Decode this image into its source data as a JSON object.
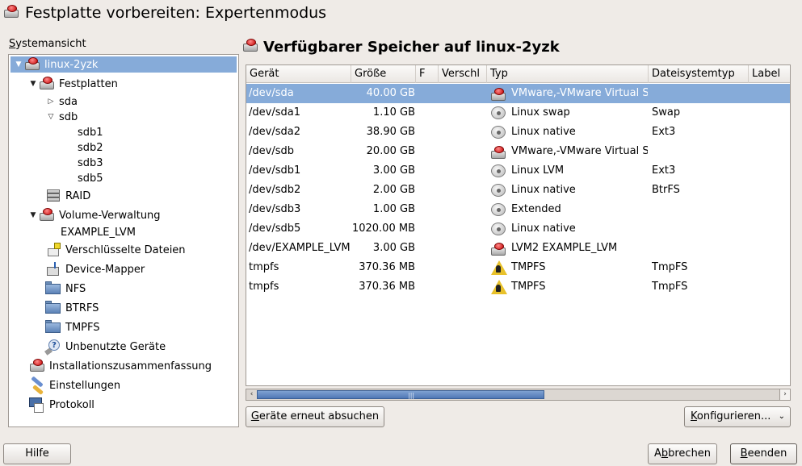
{
  "window": {
    "title": "Festplatte vorbereiten: Expertenmodus"
  },
  "sidebar": {
    "label": "Systemansicht",
    "tree": [
      {
        "label": "linux-2yzk",
        "icon": "harddisk-red-icon",
        "expanded": true,
        "selected": true
      },
      {
        "label": "Festplatten",
        "icon": "harddisk-red-icon",
        "expanded": true
      },
      {
        "label": "sda",
        "expanded": false
      },
      {
        "label": "sdb",
        "expanded": true
      },
      {
        "label": "sdb1"
      },
      {
        "label": "sdb2"
      },
      {
        "label": "sdb3"
      },
      {
        "label": "sdb5"
      },
      {
        "label": "RAID",
        "icon": "raid-icon"
      },
      {
        "label": "Volume-Verwaltung",
        "icon": "harddisk-red-icon",
        "expanded": true
      },
      {
        "label": "EXAMPLE_LVM"
      },
      {
        "label": "Verschlüsselte Dateien",
        "icon": "encrypted-files-icon"
      },
      {
        "label": "Device-Mapper",
        "icon": "device-mapper-icon"
      },
      {
        "label": "NFS",
        "icon": "folder-icon"
      },
      {
        "label": "BTRFS",
        "icon": "folder-icon"
      },
      {
        "label": "TMPFS",
        "icon": "folder-icon"
      },
      {
        "label": "Unbenutzte Geräte",
        "icon": "unused-devices-icon"
      },
      {
        "label": "Installationszusammenfassung",
        "icon": "harddisk-red-icon"
      },
      {
        "label": "Einstellungen",
        "icon": "settings-icon"
      },
      {
        "label": "Protokoll",
        "icon": "log-icon"
      }
    ]
  },
  "main": {
    "title": "Verfügbarer Speicher auf linux-2yzk",
    "columns": [
      "Gerät",
      "Größe",
      "F",
      "Verschl",
      "Typ",
      "Dateisystemtyp",
      "Label"
    ],
    "rows": [
      {
        "device": "/dev/sda",
        "size": "40.00 GB",
        "type": "VMware,-VMware Virtual S",
        "fs": "",
        "icon": "harddisk-red-icon",
        "selected": true
      },
      {
        "device": "/dev/sda1",
        "size": "1.10 GB",
        "type": "Linux swap",
        "fs": "Swap",
        "icon": "harddisk-gray-icon"
      },
      {
        "device": "/dev/sda2",
        "size": "38.90 GB",
        "type": "Linux native",
        "fs": "Ext3",
        "icon": "harddisk-gray-icon"
      },
      {
        "device": "/dev/sdb",
        "size": "20.00 GB",
        "type": "VMware,-VMware Virtual S",
        "fs": "",
        "icon": "harddisk-red-icon"
      },
      {
        "device": "/dev/sdb1",
        "size": "3.00 GB",
        "type": "Linux LVM",
        "fs": "Ext3",
        "icon": "harddisk-gray-icon"
      },
      {
        "device": "/dev/sdb2",
        "size": "2.00 GB",
        "type": "Linux native",
        "fs": "BtrFS",
        "icon": "harddisk-gray-icon"
      },
      {
        "device": "/dev/sdb3",
        "size": "1.00 GB",
        "type": "Extended",
        "fs": "",
        "icon": "harddisk-gray-icon"
      },
      {
        "device": "/dev/sdb5",
        "size": "1020.00 MB",
        "type": "Linux native",
        "fs": "",
        "icon": "harddisk-gray-icon"
      },
      {
        "device": "/dev/EXAMPLE_LVM",
        "size": "3.00 GB",
        "type": "LVM2 EXAMPLE_LVM",
        "fs": "",
        "icon": "harddisk-red-icon"
      },
      {
        "device": "tmpfs",
        "size": "370.36 MB",
        "type": "TMPFS",
        "fs": "TmpFS",
        "icon": "tmpfs-icon"
      },
      {
        "device": "tmpfs",
        "size": "370.36 MB",
        "type": "TMPFS",
        "fs": "TmpFS",
        "icon": "tmpfs-icon"
      }
    ],
    "scrollbar": {
      "position": 0,
      "visible_fraction": 0.54
    }
  },
  "buttons": {
    "rescan": "Geräte erneut absuchen",
    "configure": "Konfigurieren...",
    "help": "Hilfe",
    "cancel": "Abbrechen",
    "finish": "Beenden"
  },
  "colors": {
    "selection": "#86abd9",
    "window_bg": "#efebe7"
  }
}
